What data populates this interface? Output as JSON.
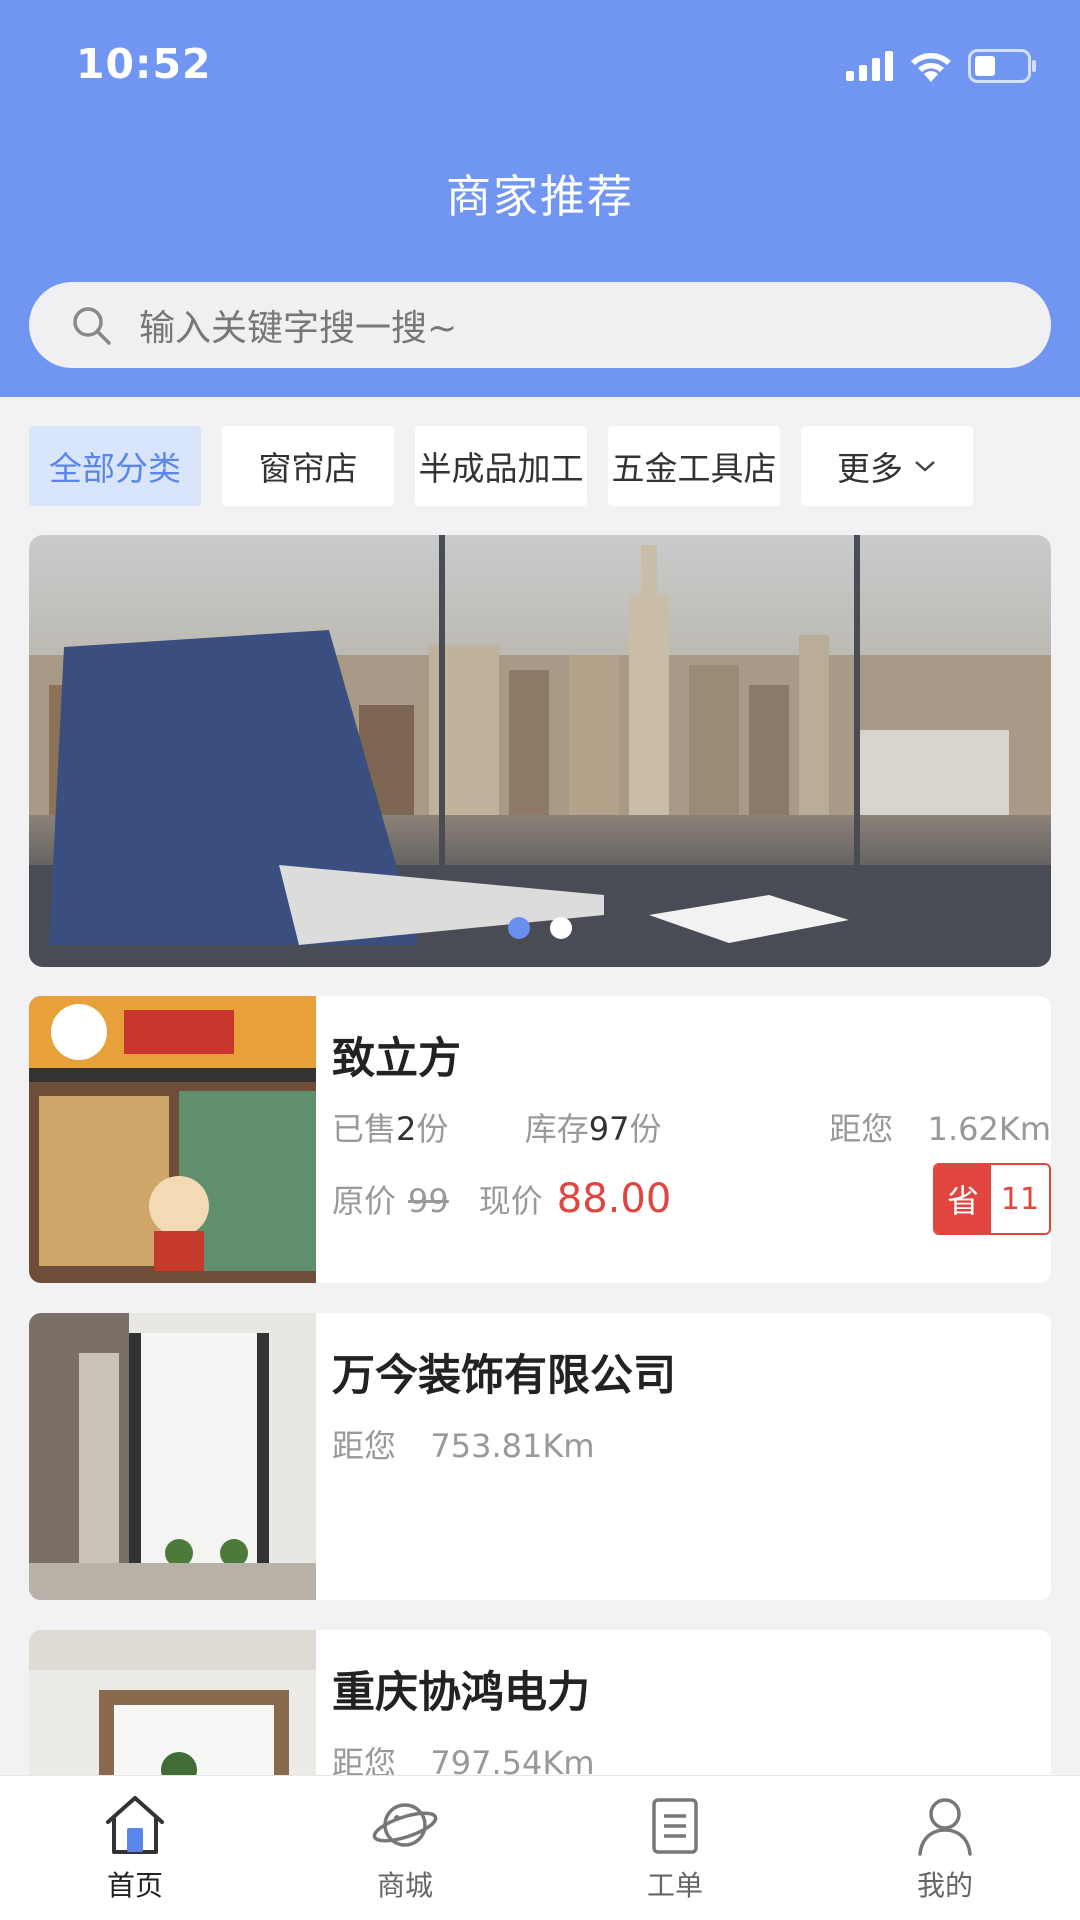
{
  "status_bar": {
    "time": "10:52"
  },
  "header": {
    "title": "商家推荐"
  },
  "search": {
    "placeholder": "输入关键字搜一搜~"
  },
  "categories": [
    {
      "label": "全部分类",
      "active": true
    },
    {
      "label": "窗帘店"
    },
    {
      "label": "半成品加工"
    },
    {
      "label": "五金工具店"
    },
    {
      "label": "更多"
    }
  ],
  "banner": {
    "slide_count": 2,
    "active_index": 0
  },
  "merchants": [
    {
      "name": "致立方",
      "sold_prefix": "已售",
      "sold": "2",
      "sold_unit": "份",
      "stock_prefix": "库存",
      "stock": "97",
      "stock_unit": "份",
      "distance_label": "距您",
      "distance": "1.62Km",
      "orig_label": "原价",
      "orig_price": "99",
      "now_label": "现价",
      "now_price": "88.00",
      "save_label": "省",
      "save_amount": "11"
    },
    {
      "name": "万今装饰有限公司",
      "distance_label": "距您",
      "distance": "753.81Km"
    },
    {
      "name": "重庆协鸿电力",
      "distance_label": "距您",
      "distance": "797.54Km"
    }
  ],
  "tabbar": [
    {
      "label": "首页",
      "icon": "home-icon",
      "active": true
    },
    {
      "label": "商城",
      "icon": "planet-icon"
    },
    {
      "label": "工单",
      "icon": "document-icon"
    },
    {
      "label": "我的",
      "icon": "user-icon"
    }
  ],
  "colors": {
    "accent": "#7196f2",
    "price_red": "#e0453f",
    "active_tab_bg": "#d9e5fb"
  }
}
